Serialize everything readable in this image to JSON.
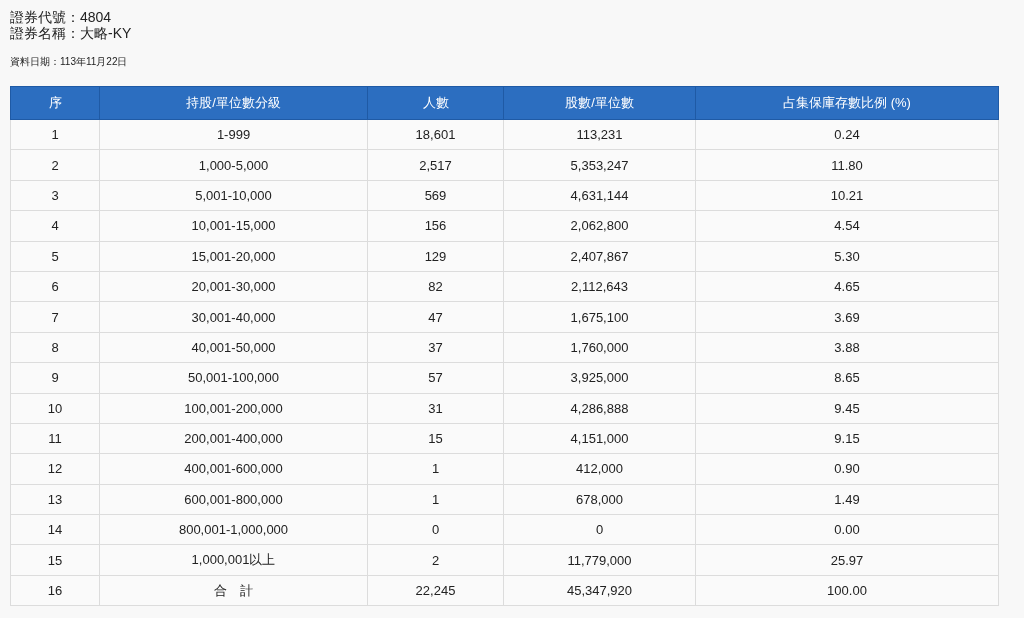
{
  "info": [
    {
      "label": "證券代號：",
      "value": "4804"
    },
    {
      "label": "證券名稱：",
      "value": "大略-KY"
    }
  ],
  "data_date": "資料日期：113年11月22日",
  "table": {
    "columns": [
      "序",
      "持股/單位數分級",
      "人數",
      "股數/單位數",
      "占集保庫存數比例 (%)"
    ],
    "rows": [
      [
        "1",
        "1-999",
        "18,601",
        "113,231",
        "0.24"
      ],
      [
        "2",
        "1,000-5,000",
        "2,517",
        "5,353,247",
        "11.80"
      ],
      [
        "3",
        "5,001-10,000",
        "569",
        "4,631,144",
        "10.21"
      ],
      [
        "4",
        "10,001-15,000",
        "156",
        "2,062,800",
        "4.54"
      ],
      [
        "5",
        "15,001-20,000",
        "129",
        "2,407,867",
        "5.30"
      ],
      [
        "6",
        "20,001-30,000",
        "82",
        "2,112,643",
        "4.65"
      ],
      [
        "7",
        "30,001-40,000",
        "47",
        "1,675,100",
        "3.69"
      ],
      [
        "8",
        "40,001-50,000",
        "37",
        "1,760,000",
        "3.88"
      ],
      [
        "9",
        "50,001-100,000",
        "57",
        "3,925,000",
        "8.65"
      ],
      [
        "10",
        "100,001-200,000",
        "31",
        "4,286,888",
        "9.45"
      ],
      [
        "11",
        "200,001-400,000",
        "15",
        "4,151,000",
        "9.15"
      ],
      [
        "12",
        "400,001-600,000",
        "1",
        "412,000",
        "0.90"
      ],
      [
        "13",
        "600,001-800,000",
        "1",
        "678,000",
        "1.49"
      ],
      [
        "14",
        "800,001-1,000,000",
        "0",
        "0",
        "0.00"
      ],
      [
        "15",
        "1,000,001以上",
        "2",
        "11,779,000",
        "25.97"
      ],
      [
        "16",
        "合　計",
        "22,245",
        "45,347,920",
        "100.00"
      ]
    ]
  }
}
